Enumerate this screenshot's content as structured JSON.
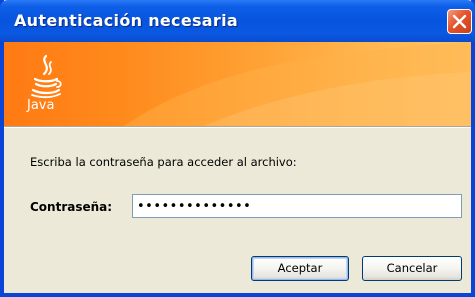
{
  "window": {
    "title": "Autenticación necesaria"
  },
  "banner": {
    "logo_text": "Java"
  },
  "dialog": {
    "prompt": "Escriba la contraseña para acceder al archivo:",
    "password_label": "Contraseña:",
    "password_value": "••••••••••••••"
  },
  "buttons": {
    "accept_label": "Aceptar",
    "cancel_label": "Cancelar"
  },
  "colors": {
    "titlebar": "#0754de",
    "banner_start": "#ff7a14",
    "banner_end": "#ffc566",
    "close_button": "#e4532b",
    "dialog_bg": "#ece9d8"
  },
  "icons": {
    "close": "close-icon",
    "logo": "java-logo-icon"
  }
}
